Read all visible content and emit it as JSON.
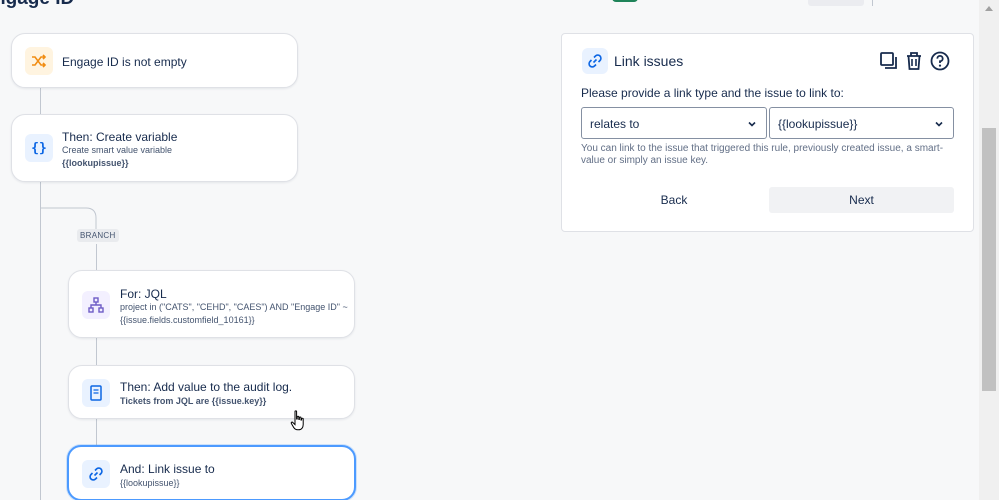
{
  "header": {
    "title": "ngage ID"
  },
  "flow": {
    "condition": {
      "title": "Engage ID is not empty",
      "icon": "shuffle-icon"
    },
    "create_variable": {
      "title": "Then: Create variable",
      "sub1": "Create smart value variable",
      "sub2": "{{lookupissue}}",
      "icon": "braces-icon"
    },
    "branch_label": "BRANCH",
    "for_jql": {
      "title": "For: JQL",
      "sub1": "project in (\"CATS\", \"CEHD\", \"CAES\") AND \"Engage ID\" ~",
      "sub2": "{{issue.fields.customfield_10161}}",
      "icon": "hierarchy-icon"
    },
    "audit_log": {
      "title": "Then: Add value to the audit log.",
      "sub1": "Tickets from JQL are {{issue.key}}",
      "icon": "document-icon"
    },
    "link_issue": {
      "title": "And: Link issue to",
      "sub1": "{{lookupissue}}",
      "icon": "link-icon"
    }
  },
  "panel": {
    "title": "Link issues",
    "prompt": "Please provide a link type and the issue to link to:",
    "link_type": "relates to",
    "issue_value": "{{lookupissue}}",
    "help": "You can link to the issue that triggered this rule, previously created issue, a smart-value or simply an issue key.",
    "back_label": "Back",
    "next_label": "Next"
  },
  "colors": {
    "accent": "#0c66e4",
    "selected_border": "#4c9aff",
    "condition_icon_bg": "#fff4e0",
    "condition_icon": "#f18d13"
  }
}
